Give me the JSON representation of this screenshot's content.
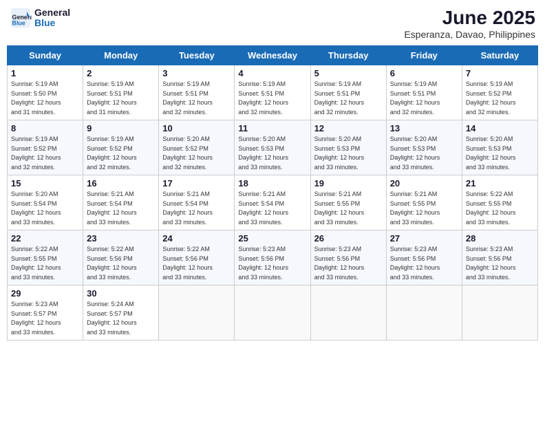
{
  "header": {
    "logo_line1": "General",
    "logo_line2": "Blue",
    "title": "June 2025",
    "subtitle": "Esperanza, Davao, Philippines"
  },
  "columns": [
    "Sunday",
    "Monday",
    "Tuesday",
    "Wednesday",
    "Thursday",
    "Friday",
    "Saturday"
  ],
  "weeks": [
    {
      "days": [
        {
          "num": "1",
          "info": "Sunrise: 5:19 AM\nSunset: 5:50 PM\nDaylight: 12 hours\nand 31 minutes."
        },
        {
          "num": "2",
          "info": "Sunrise: 5:19 AM\nSunset: 5:51 PM\nDaylight: 12 hours\nand 31 minutes."
        },
        {
          "num": "3",
          "info": "Sunrise: 5:19 AM\nSunset: 5:51 PM\nDaylight: 12 hours\nand 32 minutes."
        },
        {
          "num": "4",
          "info": "Sunrise: 5:19 AM\nSunset: 5:51 PM\nDaylight: 12 hours\nand 32 minutes."
        },
        {
          "num": "5",
          "info": "Sunrise: 5:19 AM\nSunset: 5:51 PM\nDaylight: 12 hours\nand 32 minutes."
        },
        {
          "num": "6",
          "info": "Sunrise: 5:19 AM\nSunset: 5:51 PM\nDaylight: 12 hours\nand 32 minutes."
        },
        {
          "num": "7",
          "info": "Sunrise: 5:19 AM\nSunset: 5:52 PM\nDaylight: 12 hours\nand 32 minutes."
        }
      ]
    },
    {
      "days": [
        {
          "num": "8",
          "info": "Sunrise: 5:19 AM\nSunset: 5:52 PM\nDaylight: 12 hours\nand 32 minutes."
        },
        {
          "num": "9",
          "info": "Sunrise: 5:19 AM\nSunset: 5:52 PM\nDaylight: 12 hours\nand 32 minutes."
        },
        {
          "num": "10",
          "info": "Sunrise: 5:20 AM\nSunset: 5:52 PM\nDaylight: 12 hours\nand 32 minutes."
        },
        {
          "num": "11",
          "info": "Sunrise: 5:20 AM\nSunset: 5:53 PM\nDaylight: 12 hours\nand 33 minutes."
        },
        {
          "num": "12",
          "info": "Sunrise: 5:20 AM\nSunset: 5:53 PM\nDaylight: 12 hours\nand 33 minutes."
        },
        {
          "num": "13",
          "info": "Sunrise: 5:20 AM\nSunset: 5:53 PM\nDaylight: 12 hours\nand 33 minutes."
        },
        {
          "num": "14",
          "info": "Sunrise: 5:20 AM\nSunset: 5:53 PM\nDaylight: 12 hours\nand 33 minutes."
        }
      ]
    },
    {
      "days": [
        {
          "num": "15",
          "info": "Sunrise: 5:20 AM\nSunset: 5:54 PM\nDaylight: 12 hours\nand 33 minutes."
        },
        {
          "num": "16",
          "info": "Sunrise: 5:21 AM\nSunset: 5:54 PM\nDaylight: 12 hours\nand 33 minutes."
        },
        {
          "num": "17",
          "info": "Sunrise: 5:21 AM\nSunset: 5:54 PM\nDaylight: 12 hours\nand 33 minutes."
        },
        {
          "num": "18",
          "info": "Sunrise: 5:21 AM\nSunset: 5:54 PM\nDaylight: 12 hours\nand 33 minutes."
        },
        {
          "num": "19",
          "info": "Sunrise: 5:21 AM\nSunset: 5:55 PM\nDaylight: 12 hours\nand 33 minutes."
        },
        {
          "num": "20",
          "info": "Sunrise: 5:21 AM\nSunset: 5:55 PM\nDaylight: 12 hours\nand 33 minutes."
        },
        {
          "num": "21",
          "info": "Sunrise: 5:22 AM\nSunset: 5:55 PM\nDaylight: 12 hours\nand 33 minutes."
        }
      ]
    },
    {
      "days": [
        {
          "num": "22",
          "info": "Sunrise: 5:22 AM\nSunset: 5:55 PM\nDaylight: 12 hours\nand 33 minutes."
        },
        {
          "num": "23",
          "info": "Sunrise: 5:22 AM\nSunset: 5:56 PM\nDaylight: 12 hours\nand 33 minutes."
        },
        {
          "num": "24",
          "info": "Sunrise: 5:22 AM\nSunset: 5:56 PM\nDaylight: 12 hours\nand 33 minutes."
        },
        {
          "num": "25",
          "info": "Sunrise: 5:23 AM\nSunset: 5:56 PM\nDaylight: 12 hours\nand 33 minutes."
        },
        {
          "num": "26",
          "info": "Sunrise: 5:23 AM\nSunset: 5:56 PM\nDaylight: 12 hours\nand 33 minutes."
        },
        {
          "num": "27",
          "info": "Sunrise: 5:23 AM\nSunset: 5:56 PM\nDaylight: 12 hours\nand 33 minutes."
        },
        {
          "num": "28",
          "info": "Sunrise: 5:23 AM\nSunset: 5:56 PM\nDaylight: 12 hours\nand 33 minutes."
        }
      ]
    },
    {
      "days": [
        {
          "num": "29",
          "info": "Sunrise: 5:23 AM\nSunset: 5:57 PM\nDaylight: 12 hours\nand 33 minutes."
        },
        {
          "num": "30",
          "info": "Sunrise: 5:24 AM\nSunset: 5:57 PM\nDaylight: 12 hours\nand 33 minutes."
        },
        {
          "num": "",
          "info": ""
        },
        {
          "num": "",
          "info": ""
        },
        {
          "num": "",
          "info": ""
        },
        {
          "num": "",
          "info": ""
        },
        {
          "num": "",
          "info": ""
        }
      ]
    }
  ]
}
